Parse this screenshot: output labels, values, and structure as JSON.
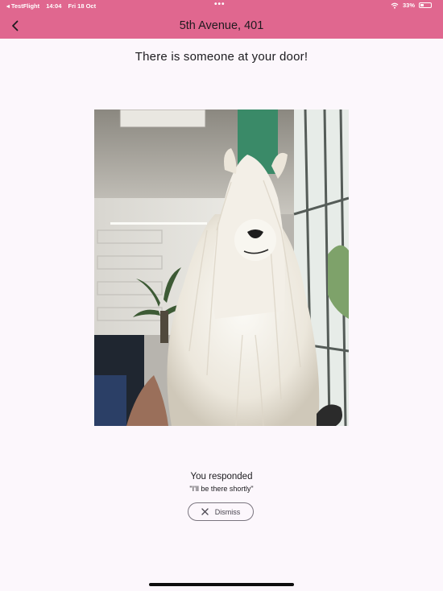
{
  "status_bar": {
    "carrier": "◂ TestFlight",
    "time": "14:04",
    "date": "Fri 18 Oct",
    "battery": "33%",
    "battery_level": 0.33,
    "icons": [
      "wifi-icon",
      "battery-icon"
    ]
  },
  "header": {
    "back_icon": "chevron-left-icon",
    "title": "5th Avenue, 401"
  },
  "main": {
    "headline": "There is someone at your door!",
    "photo_subject": "doorbell-snapshot",
    "responded_label": "You responded",
    "response": "\"I'll be there shortly\"",
    "dismiss_icon": "close-icon",
    "dismiss_label": "Dismiss"
  },
  "colors": {
    "header_bg": "#e0678f",
    "page_bg": "#fcf7fc",
    "text": "#1c1b1f",
    "outline": "#7a757f"
  }
}
